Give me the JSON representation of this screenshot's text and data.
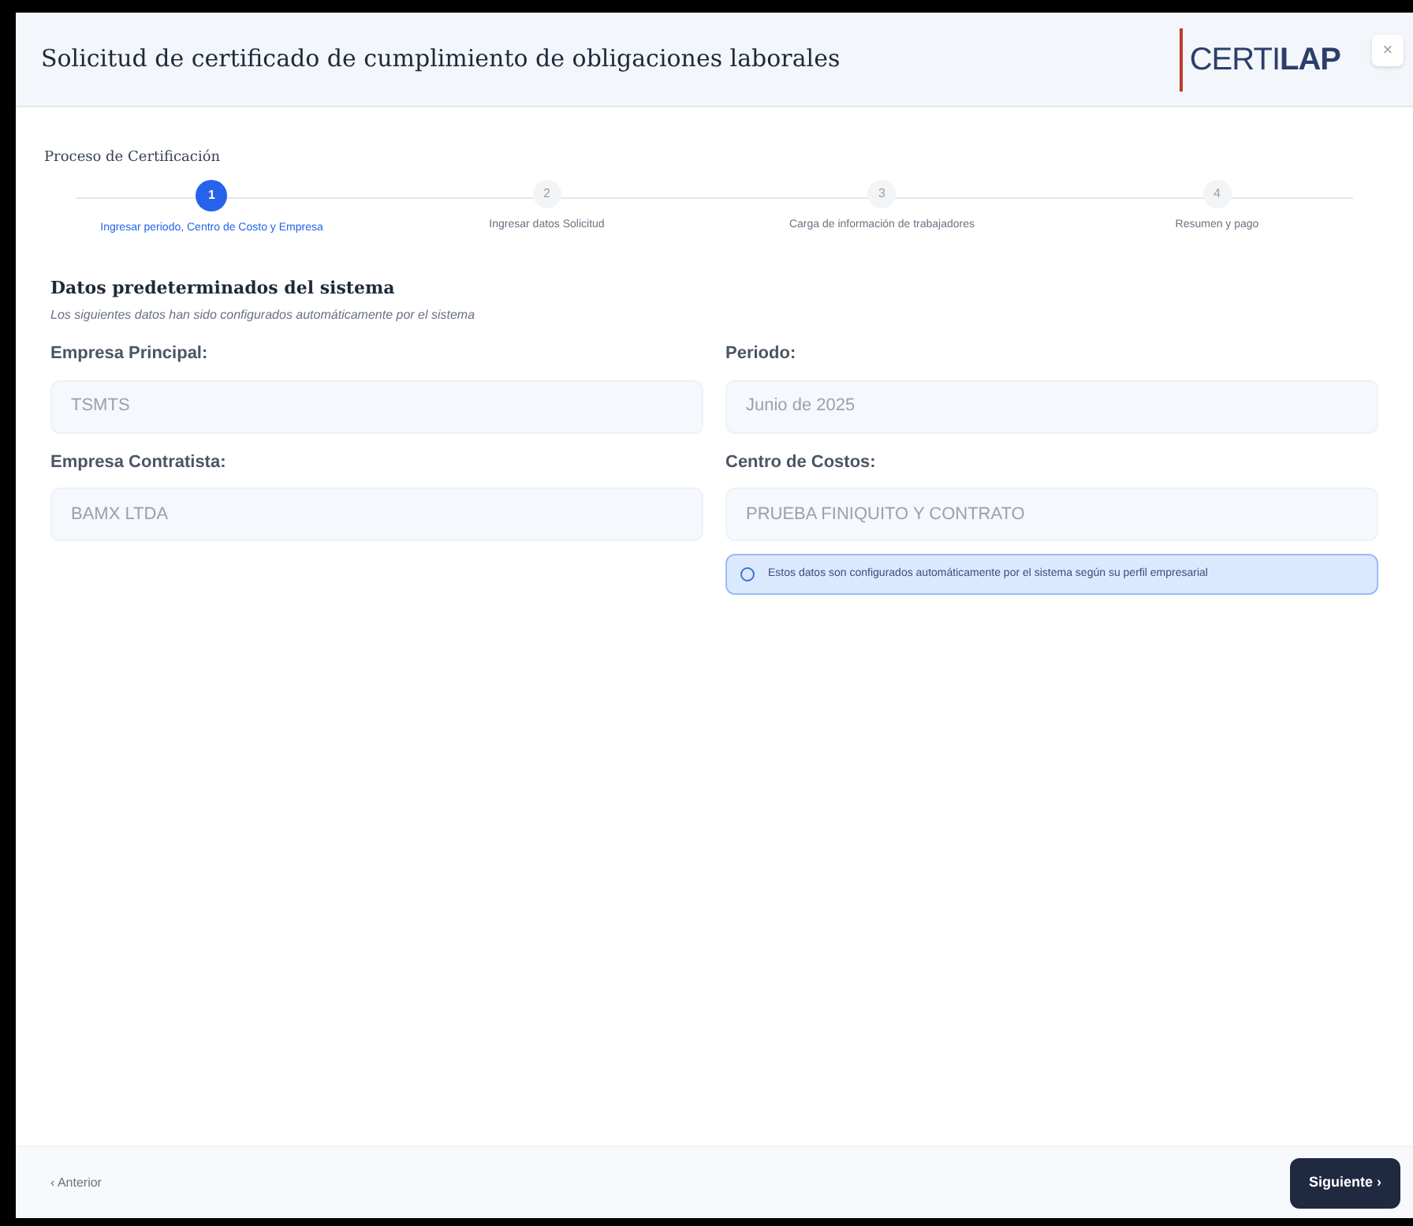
{
  "dialog": {
    "title": "Solicitud de certificado de cumplimiento de obligaciones laborales",
    "logo": "CERTI**LAP**",
    "close": "×"
  },
  "stepper": {
    "title": "Proceso de Certificación",
    "steps": [
      {
        "number": "1",
        "label": "Ingresar periodo, Centro de Costo y Empresa",
        "selected": true
      },
      {
        "number": "2",
        "label": "Ingresar datos Solicitud",
        "selected": false
      },
      {
        "number": "3",
        "label": "Carga de información de trabajadores",
        "selected": false
      },
      {
        "number": "4",
        "label": "Resumen y pago",
        "selected": false
      }
    ]
  },
  "section": {
    "title": "Datos predeterminados del sistema",
    "subtitle": "Los siguientes datos han sido configurados automáticamente por el sistema"
  },
  "fields": [
    {
      "label": "Empresa Principal:",
      "value": "TSMTS"
    },
    {
      "label": "Periodo:",
      "value": "Junio de 2025"
    },
    {
      "label": "Empresa Contratista:",
      "value": "BAMX LTDA"
    },
    {
      "label": "Centro de Costos:",
      "value": "PRUEBA FINIQUITO Y CONTRATO"
    }
  ],
  "info": "Estos datos son configurados automáticamente por el sistema según su perfil empresarial",
  "footer": {
    "back": {
      "label": "‹ Anterior",
      "disabled": true
    },
    "next": {
      "label": "Siguiente ›",
      "disabled": false
    }
  }
}
